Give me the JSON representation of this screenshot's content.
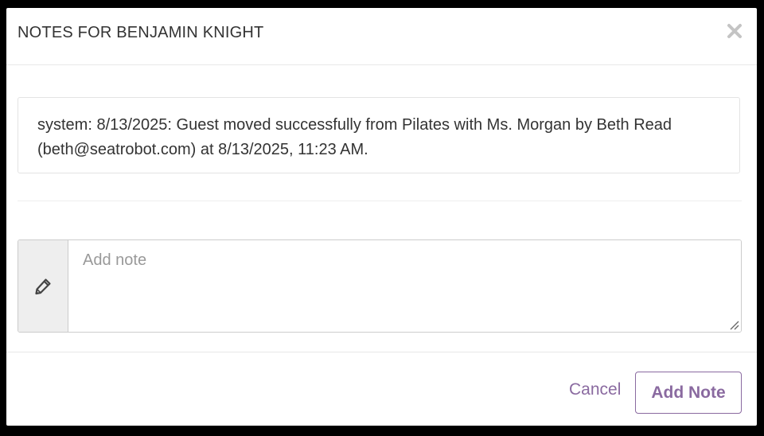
{
  "modal": {
    "title": "NOTES FOR BENJAMIN KNIGHT",
    "close_icon": "close-icon"
  },
  "notes": [
    {
      "text": "system: 8/13/2025: Guest moved successfully from Pilates with Ms. Morgan by Beth Read (beth@seatrobot.com) at 8/13/2025, 11:23 AM."
    }
  ],
  "note_input": {
    "placeholder": "Add note",
    "value": "",
    "icon": "pencil-icon"
  },
  "footer": {
    "cancel_label": "Cancel",
    "add_label": "Add Note"
  },
  "colors": {
    "accent": "#8a6aa0",
    "text": "#333333",
    "placeholder": "#999999",
    "addon_bg": "#eeeeee"
  }
}
